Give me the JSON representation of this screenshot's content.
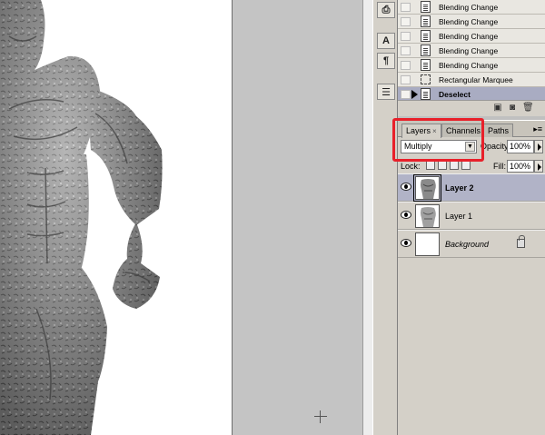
{
  "history": {
    "items": [
      {
        "label": "Blending Change",
        "icon": "history-state-icon"
      },
      {
        "label": "Blending Change",
        "icon": "history-state-icon"
      },
      {
        "label": "Blending Change",
        "icon": "history-state-icon"
      },
      {
        "label": "Blending Change",
        "icon": "history-state-icon"
      },
      {
        "label": "Blending Change",
        "icon": "history-state-icon"
      },
      {
        "label": "Rectangular Marquee",
        "icon": "marquee-icon"
      },
      {
        "label": "Deselect",
        "icon": "history-state-icon",
        "active": true
      }
    ]
  },
  "layers_panel": {
    "tabs": [
      "Layers",
      "Channels",
      "Paths"
    ],
    "active_tab": "Layers",
    "tab_close": "×",
    "blend_mode": "Multiply",
    "opacity_label": "Opacity:",
    "opacity_value": "100%",
    "lock_label": "Lock:",
    "fill_label": "Fill:",
    "fill_value": "100%",
    "layers": [
      {
        "name": "Layer 2",
        "selected": true,
        "visible": true
      },
      {
        "name": "Layer 1",
        "selected": false,
        "visible": true
      },
      {
        "name": "Background",
        "selected": false,
        "visible": true,
        "locked": true
      }
    ]
  },
  "tool_strip": {
    "icons": [
      "history-brush-icon",
      "character-icon",
      "paragraph-icon",
      "layer-comps-icon"
    ]
  },
  "annotation": {
    "color": "#e8202a"
  }
}
